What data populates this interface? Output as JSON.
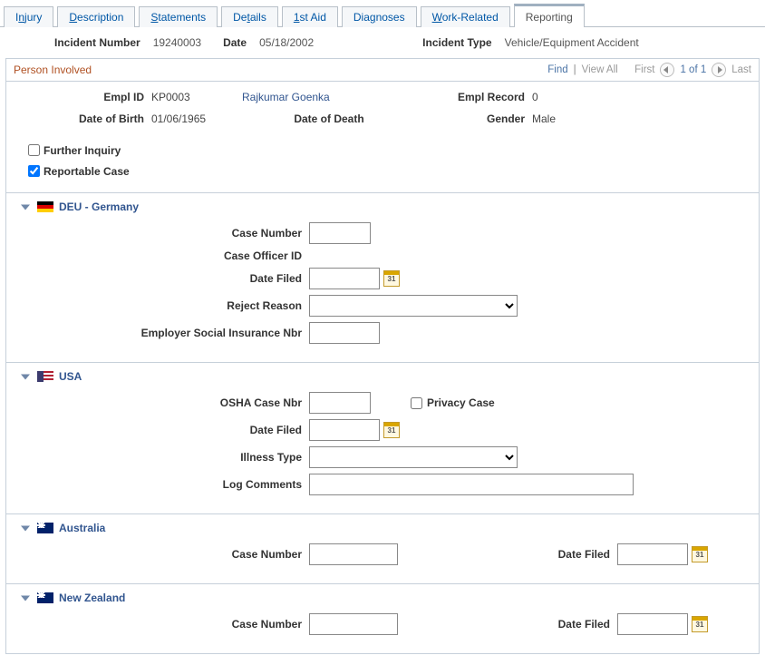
{
  "tabs": {
    "injury": {
      "pre": "I",
      "key": "n",
      "post": "jury"
    },
    "description": {
      "pre": "",
      "key": "D",
      "post": "escription"
    },
    "statements": {
      "pre": "",
      "key": "S",
      "post": "tatements"
    },
    "details": {
      "pre": "De",
      "key": "t",
      "post": "ails"
    },
    "firstaid": {
      "pre": "",
      "key": "1",
      "post": "st Aid"
    },
    "diagnoses": {
      "pre": "Dia",
      "key": "g",
      "post": "noses"
    },
    "workrelated": {
      "pre": "",
      "key": "W",
      "post": "ork-Related"
    },
    "reporting": "Reporting"
  },
  "summary": {
    "incident_number_label": "Incident Number",
    "incident_number": "19240003",
    "date_label": "Date",
    "date": "05/18/2002",
    "incident_type_label": "Incident Type",
    "incident_type": "Vehicle/Equipment Accident"
  },
  "person_section": {
    "title": "Person Involved",
    "find": "Find",
    "viewall": "View All",
    "first": "First",
    "counter": "1 of 1",
    "last": "Last"
  },
  "person": {
    "emplid_label": "Empl ID",
    "emplid": "KP0003",
    "name": "Rajkumar Goenka",
    "empl_record_label": "Empl Record",
    "empl_record": "0",
    "dob_label": "Date of Birth",
    "dob": "01/06/1965",
    "dod_label": "Date of Death",
    "gender_label": "Gender",
    "gender": "Male"
  },
  "checks": {
    "further_inquiry": "Further Inquiry",
    "reportable_case": "Reportable Case",
    "further_inquiry_checked": false,
    "reportable_case_checked": true
  },
  "deu": {
    "title": "DEU - Germany",
    "case_number": "Case Number",
    "case_officer_id": "Case Officer ID",
    "date_filed": "Date Filed",
    "reject_reason": "Reject Reason",
    "employer_sin": "Employer Social Insurance Nbr"
  },
  "usa": {
    "title": "USA",
    "osha_case_nbr": "OSHA Case Nbr",
    "privacy_case": "Privacy Case",
    "date_filed": "Date Filed",
    "illness_type": "Illness Type",
    "log_comments": "Log Comments"
  },
  "aus": {
    "title": "Australia",
    "case_number": "Case Number",
    "date_filed": "Date Filed"
  },
  "nzl": {
    "title": "New Zealand",
    "case_number": "Case Number",
    "date_filed": "Date Filed"
  }
}
